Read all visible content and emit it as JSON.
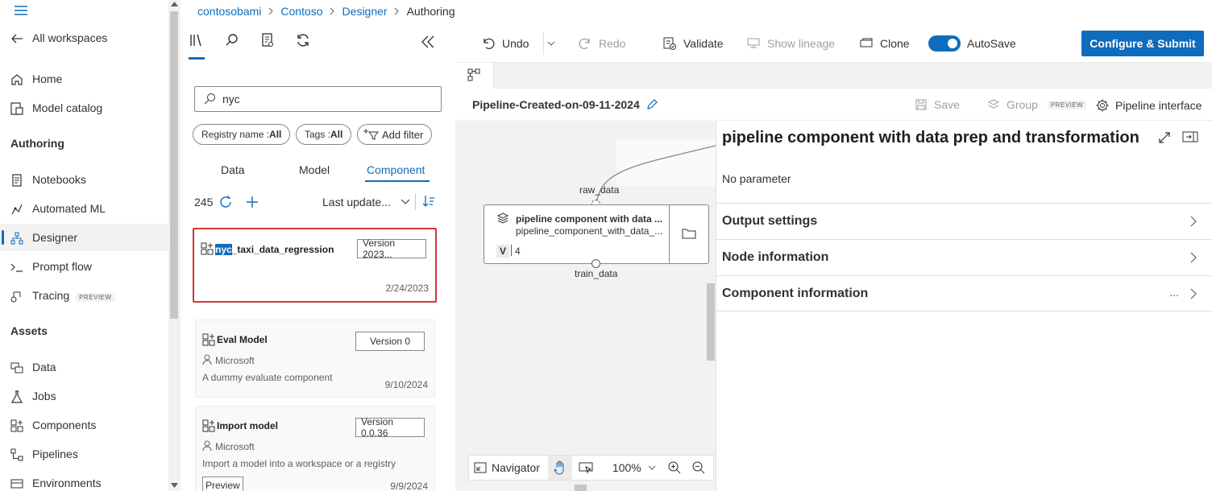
{
  "leftnav": {
    "back_label": "All workspaces",
    "items_top": [
      {
        "label": "Home",
        "icon": "home-icon"
      },
      {
        "label": "Model catalog",
        "icon": "model-catalog-icon"
      }
    ],
    "authoring_heading": "Authoring",
    "authoring_items": [
      {
        "label": "Notebooks",
        "icon": "notebook-icon"
      },
      {
        "label": "Automated ML",
        "icon": "automated-ml-icon"
      },
      {
        "label": "Designer",
        "icon": "designer-icon",
        "active": true
      },
      {
        "label": "Prompt flow",
        "icon": "prompt-flow-icon"
      },
      {
        "label": "Tracing",
        "icon": "tracing-icon",
        "badge": "PREVIEW"
      }
    ],
    "assets_heading": "Assets",
    "assets_items": [
      {
        "label": "Data",
        "icon": "data-icon"
      },
      {
        "label": "Jobs",
        "icon": "jobs-icon"
      },
      {
        "label": "Components",
        "icon": "components-icon"
      },
      {
        "label": "Pipelines",
        "icon": "pipelines-icon"
      },
      {
        "label": "Environments",
        "icon": "environments-icon"
      }
    ]
  },
  "breadcrumb": [
    "contosobami",
    "Contoso",
    "Designer",
    "Authoring"
  ],
  "library": {
    "search_value": "nyc",
    "chips": {
      "registry_label": "Registry name : ",
      "registry_value": "All",
      "tags_label": "Tags : ",
      "tags_value": "All",
      "add_filter": "Add filter"
    },
    "tabs": [
      "Data",
      "Model",
      "Component"
    ],
    "active_tab": "Component",
    "count": "245",
    "sort_label": "Last update...",
    "cards": [
      {
        "highlight": "nyc",
        "title_rest": "_taxi_data_regression",
        "version": "Version 2023...",
        "date": "2/24/2023"
      },
      {
        "title": "Eval Model",
        "version": "Version 0",
        "author": "Microsoft",
        "desc": "A dummy evaluate component",
        "date": "9/10/2024"
      },
      {
        "title": "Import model",
        "version": "Version 0.0.36",
        "author": "Microsoft",
        "desc": "Import a model into a workspace or a registry",
        "date": "9/9/2024",
        "tag": "Preview"
      }
    ]
  },
  "toolbar": {
    "undo": "Undo",
    "redo": "Redo",
    "validate": "Validate",
    "show_lineage": "Show lineage",
    "clone": "Clone",
    "autosave": "AutoSave",
    "submit": "Configure & Submit"
  },
  "pipeline": {
    "name": "Pipeline-Created-on-09-11-2024",
    "save": "Save",
    "group": "Group",
    "group_badge": "PREVIEW",
    "interface": "Pipeline interface"
  },
  "canvas": {
    "input_port_label": "raw_data",
    "output_port_label": "train_data",
    "node_title": "pipeline component with data ...",
    "node_subtitle": "pipeline_component_with_data_...",
    "node_version_badge": "V",
    "node_version": "4",
    "navigator": "Navigator",
    "zoom": "100%"
  },
  "details": {
    "title": "pipeline component with data prep and transformation",
    "no_param": "No parameter",
    "sections": [
      "Output settings",
      "Node information",
      "Component information"
    ],
    "more": "..."
  },
  "colors": {
    "accent": "#0f6cbd",
    "highlight_box": "#d13438"
  }
}
